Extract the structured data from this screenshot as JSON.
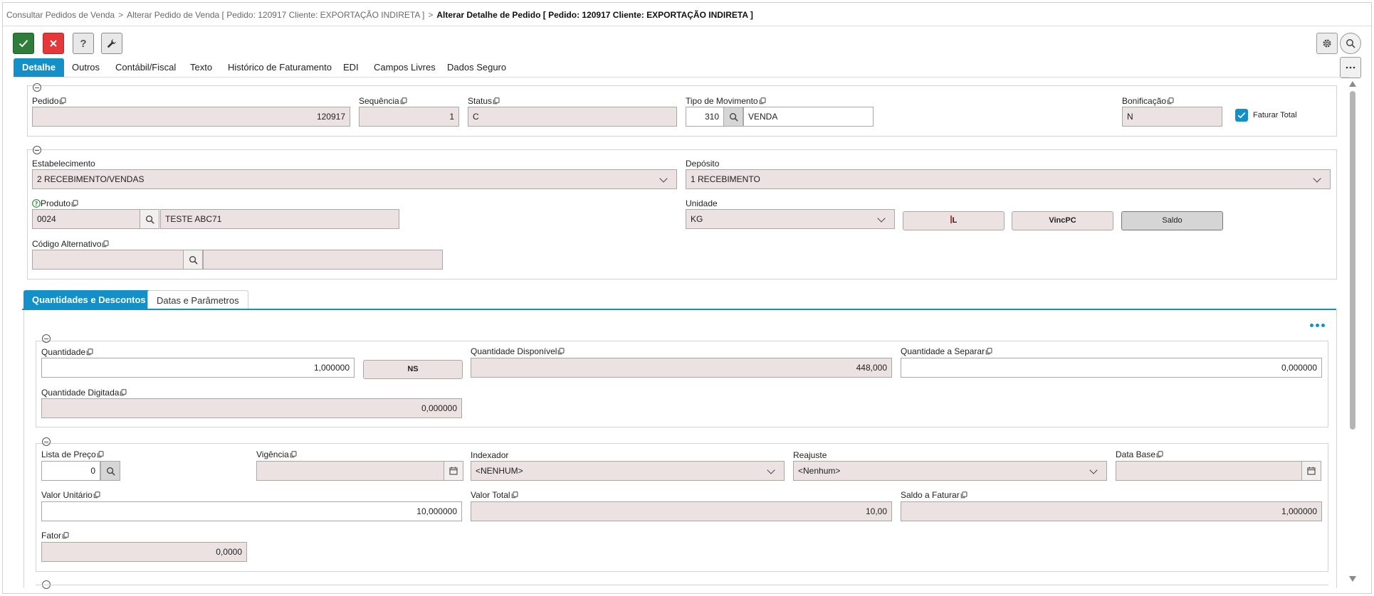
{
  "breadcrumb": {
    "item1": "Consultar Pedidos de Venda",
    "item2": "Alterar Pedido de Venda [ Pedido: 120917 Cliente: EXPORTAÇÃO INDIRETA ]",
    "current": "Alterar Detalhe de Pedido [ Pedido: 120917 Cliente: EXPORTAÇÃO INDIRETA ]",
    "separator": ">"
  },
  "toolbar": {
    "help_label": "?"
  },
  "tabs": [
    "Detalhe",
    "Outros",
    "Contábil/Fiscal",
    "Texto",
    "Histórico de Faturamento",
    "EDI",
    "Campos Livres",
    "Dados Seguro"
  ],
  "header": {
    "pedido_label": "Pedido",
    "pedido": "120917",
    "sequencia_label": "Sequência",
    "sequencia": "1",
    "status_label": "Status",
    "status": "C",
    "tipo_label": "Tipo de Movimento",
    "tipo_code": "310",
    "tipo_desc": "VENDA",
    "bonificacao_label": "Bonificação",
    "bonificacao": "N",
    "faturar_total_label": "Faturar Total"
  },
  "produto": {
    "estabelecimento_label": "Estabelecimento",
    "estabelecimento": "2 RECEBIMENTO/VENDAS",
    "deposito_label": "Depósito",
    "deposito": "1 RECEBIMENTO",
    "produto_label": "Produto",
    "produto_code": "0024",
    "produto_desc": "TESTE ABC71",
    "unidade_label": "Unidade",
    "unidade": "KG",
    "btn_l": "L",
    "btn_vincpc": "VincPC",
    "btn_saldo": "Saldo",
    "codigo_alt_label": "Código Alternativo",
    "codigo_alt": "",
    "codigo_alt_desc": ""
  },
  "subtabs": [
    "Quantidades e Descontos",
    "Datas e Parâmetros"
  ],
  "quantidades": {
    "quantidade_label": "Quantidade",
    "quantidade": "1,000000",
    "ns_button": "NS",
    "qtd_disp_label": "Quantidade Disponível",
    "qtd_disp": "448,000",
    "qtd_sep_label": "Quantidade a Separar",
    "qtd_sep": "0,000000",
    "qtd_dig_label": "Quantidade Digitada",
    "qtd_dig": "0,000000"
  },
  "precos": {
    "lista_label": "Lista de Preço",
    "lista": "0",
    "vigencia_label": "Vigência",
    "vigencia": "",
    "indexador_label": "Indexador",
    "indexador": "<NENHUM>",
    "reajuste_label": "Reajuste",
    "reajuste": "<Nenhum>",
    "data_base_label": "Data Base",
    "data_base": "",
    "valor_unit_label": "Valor Unitário",
    "valor_unit": "10,000000",
    "valor_total_label": "Valor Total",
    "valor_total": "10,00",
    "saldo_label": "Saldo a Faturar",
    "saldo": "1,000000",
    "fator_label": "Fator",
    "fator": "0,0000"
  },
  "colors": {
    "accent": "#1490c9",
    "ok": "#2e7d3a",
    "cancel": "#e5383b",
    "readonly_bg": "#ece2e2"
  }
}
